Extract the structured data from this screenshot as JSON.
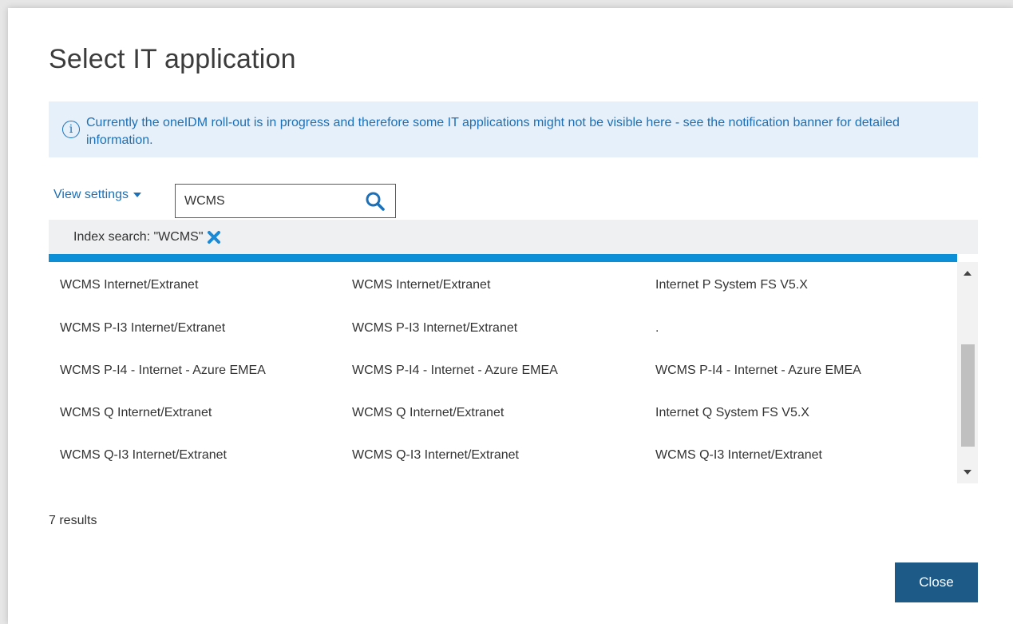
{
  "dialog": {
    "title": "Select IT application",
    "info_banner": "Currently the oneIDM roll-out is in progress and therefore some IT applications might not be visible here - see the notification banner for detailed information.",
    "view_settings_label": "View settings",
    "search": {
      "value": "WCMS",
      "icon": "search-icon"
    },
    "filter": {
      "label": "Index search: \"WCMS\"",
      "remove_icon": "close-icon"
    },
    "results": [
      [
        "WCMS Internet/Extranet",
        "WCMS Internet/Extranet",
        "Internet P System FS V5.X"
      ],
      [
        "WCMS P-I3 Internet/Extranet",
        "WCMS P-I3 Internet/Extranet",
        "."
      ],
      [
        "WCMS P-I4 - Internet - Azure EMEA",
        "WCMS P-I4 - Internet - Azure EMEA",
        "WCMS P-I4 - Internet - Azure EMEA"
      ],
      [
        "WCMS Q Internet/Extranet",
        "WCMS Q Internet/Extranet",
        "Internet Q System FS V5.X"
      ],
      [
        "WCMS Q-I3 Internet/Extranet",
        "WCMS Q-I3 Internet/Extranet",
        "WCMS Q-I3 Internet/Extranet"
      ]
    ],
    "results_count": "7 results",
    "close_label": "Close"
  },
  "colors": {
    "accent": "#1b70b8",
    "banner_bg": "#e6f0fa",
    "progress": "#0b8fd7",
    "button": "#1e5a87"
  }
}
